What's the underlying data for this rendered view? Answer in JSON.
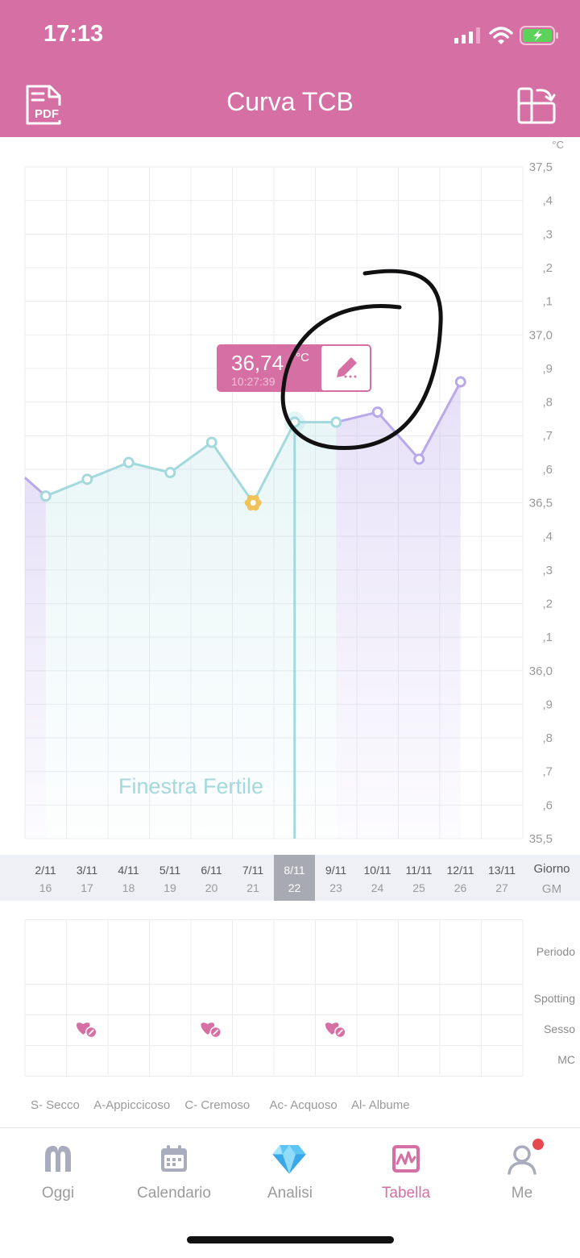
{
  "status": {
    "time": "17:13"
  },
  "header": {
    "title": "Curva TCB",
    "pdf_label": "PDF"
  },
  "chart_data": {
    "type": "line",
    "unit": "°C",
    "ylim": [
      35.5,
      37.5
    ],
    "y_ticks": [
      "37,5",
      ",4",
      ",3",
      ",2",
      ",1",
      "37,0",
      ",9",
      ",8",
      ",7",
      ",6",
      "36,5",
      ",4",
      ",3",
      ",2",
      ",1",
      "36,0",
      ",9",
      ",8",
      ",7",
      ",6",
      "35,5"
    ],
    "x_dates": [
      "2/11",
      "3/11",
      "4/11",
      "5/11",
      "6/11",
      "7/11",
      "8/11",
      "9/11",
      "10/11",
      "11/11",
      "12/11",
      "13/11"
    ],
    "x_cycle_days": [
      "16",
      "17",
      "18",
      "19",
      "20",
      "21",
      "22",
      "23",
      "24",
      "25",
      "26",
      "27"
    ],
    "values": [
      36.52,
      36.57,
      36.62,
      36.59,
      36.68,
      36.5,
      36.74,
      36.74,
      36.77,
      36.63,
      36.86,
      null
    ],
    "prev_value": 36.57,
    "ovulation_index": 5,
    "selected_index": 6,
    "fertile_window_label": "Finestra Fertile",
    "fertile_range": [
      0,
      7
    ],
    "tooltip": {
      "value": "36,74",
      "unit": "°C",
      "time": "10:27:39"
    },
    "colors": {
      "fertile": "#a3d9dd",
      "luteal": "#b9a8ea",
      "ovulation": "#f0c35a"
    }
  },
  "axis_labels": {
    "day": "Giorno",
    "cycle_day": "GM"
  },
  "events": {
    "rows": [
      "Periodo",
      "Spotting",
      "Sesso",
      "MC"
    ],
    "sex_indices": [
      1,
      4,
      7
    ]
  },
  "legend": [
    "S- Secco",
    "A-Appiccicoso",
    "C- Cremoso",
    "Ac- Acquoso",
    "Al- Albume"
  ],
  "tabs": [
    {
      "label": "Oggi",
      "icon": "today-icon"
    },
    {
      "label": "Calendario",
      "icon": "calendar-icon"
    },
    {
      "label": "Analisi",
      "icon": "diamond-icon"
    },
    {
      "label": "Tabella",
      "icon": "chart-icon",
      "active": true
    },
    {
      "label": "Me",
      "icon": "user-icon"
    }
  ]
}
